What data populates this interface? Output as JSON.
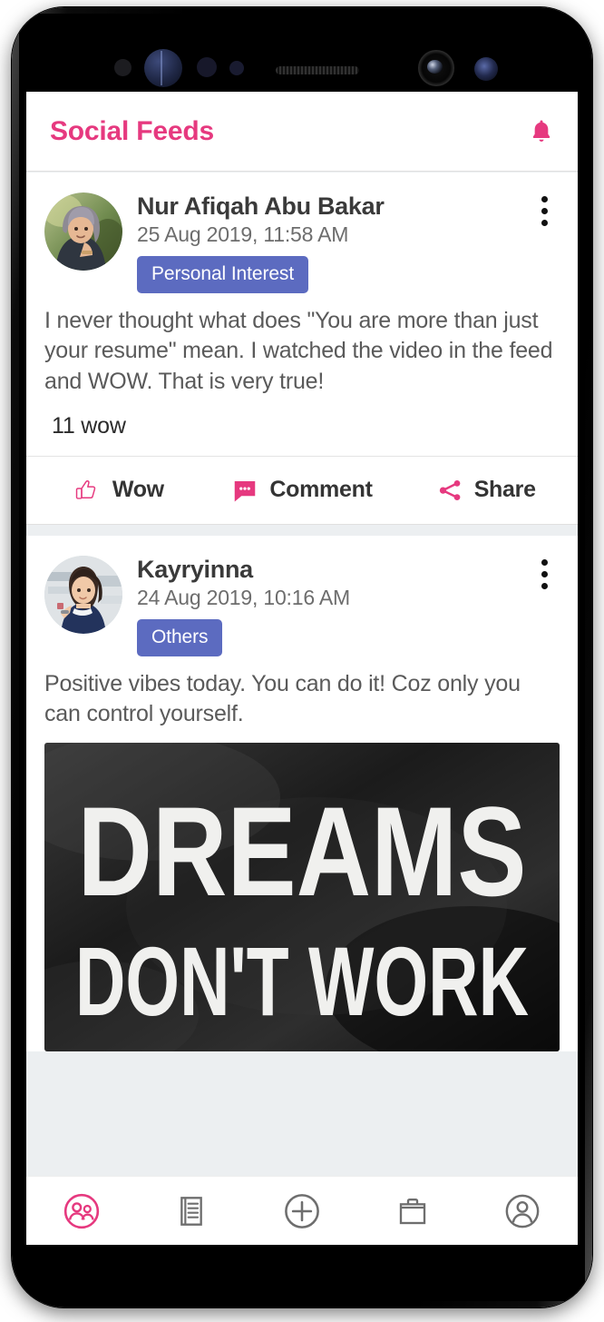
{
  "app": {
    "title": "Social Feeds",
    "notification_icon": "bell-icon",
    "accent_color": "#e6397f",
    "badge_color": "#5c6bc0"
  },
  "posts": [
    {
      "author": "Nur Afiqah Abu Bakar",
      "timestamp": "25 Aug 2019, 11:58 AM",
      "category": "Personal Interest",
      "body": "I never thought what does \"You are more than just your resume\" mean. I watched the video in the feed and WOW. That is very true!",
      "reactions": "11 wow",
      "menu_icon": "kebab-menu-icon",
      "has_image": false
    },
    {
      "author": "Kayryinna",
      "timestamp": "24 Aug 2019, 10:16 AM",
      "category": "Others",
      "body": "Positive vibes today. You can do it! Coz only you can control yourself.",
      "reactions": "",
      "menu_icon": "kebab-menu-icon",
      "has_image": true,
      "image_text_line1": "DREAMS",
      "image_text_line2": "DON'T WORK"
    }
  ],
  "actions": [
    {
      "label": "Wow",
      "icon": "thumbs-up-icon"
    },
    {
      "label": "Comment",
      "icon": "comment-bubble-icon"
    },
    {
      "label": "Share",
      "icon": "share-nodes-icon"
    }
  ],
  "bottom_nav": [
    {
      "name": "social-feeds",
      "icon": "people-circle-icon",
      "active": true
    },
    {
      "name": "news",
      "icon": "document-list-icon",
      "active": false
    },
    {
      "name": "create",
      "icon": "plus-circle-icon",
      "active": false
    },
    {
      "name": "jobs",
      "icon": "briefcase-icon",
      "active": false
    },
    {
      "name": "profile",
      "icon": "person-circle-icon",
      "active": false
    }
  ]
}
